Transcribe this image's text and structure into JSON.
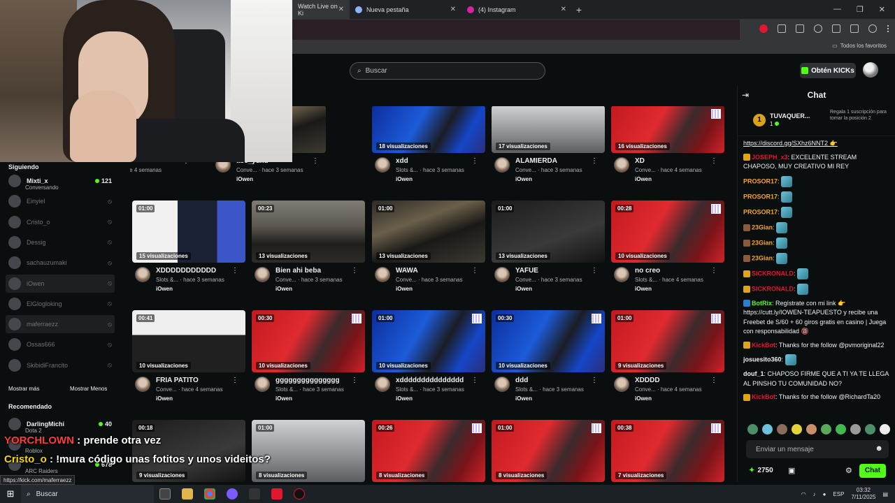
{
  "browser": {
    "tabs": [
      {
        "label": "Watch Live on Ki"
      },
      {
        "label": "Nueva pestaña"
      },
      {
        "label": "(4) Instagram"
      }
    ],
    "new_tab": "+",
    "bookmarks_all": "Todos los favoritos"
  },
  "header": {
    "search_placeholder": "Buscar",
    "get_kicks": "Obtén KICKs"
  },
  "sidebar": {
    "following_title": "Siguiendo",
    "following": [
      {
        "name": "Mixti_x",
        "sub": "Conversando",
        "count": "121",
        "live": true
      },
      {
        "name": "Einyiel",
        "live": false
      },
      {
        "name": "Cristo_o",
        "live": false
      },
      {
        "name": "Dessig",
        "live": false
      },
      {
        "name": "sachauzumaki",
        "live": false
      },
      {
        "name": "iOwen",
        "live": false
      },
      {
        "name": "ElGlogloking",
        "live": false
      },
      {
        "name": "maferraezz",
        "live": false
      },
      {
        "name": "Ossas666",
        "live": false
      },
      {
        "name": "SkibidiFrancito",
        "live": false
      }
    ],
    "show_more": "Mostrar más",
    "show_less": "Mostrar Menos",
    "recommended_title": "Recomendado",
    "recommended": [
      {
        "name": "DarlingMichi",
        "sub": "Dota 2",
        "count": "40"
      },
      {
        "name": "",
        "sub": "Roblox",
        "count": ""
      },
      {
        "name": "",
        "sub": "ARC Raiders",
        "count": "678"
      }
    ]
  },
  "videos": [
    {
      "duration": "",
      "views": "",
      "title": "",
      "meta": "IRL · hace 4 semanas",
      "channel": "iOwen",
      "style": "t-night"
    },
    {
      "duration": "",
      "views": "ciones",
      "title": "ase_yuxd",
      "meta": "Conve... · hace 3 semanas",
      "channel": "iOwen",
      "style": "t-night"
    },
    {
      "duration": "",
      "views": "18 visualizaciones",
      "title": "xdd",
      "meta": "Slots &... · hace 3 semanas",
      "channel": "iOwen",
      "style": "t-blue"
    },
    {
      "duration": "",
      "views": "17 visualizaciones",
      "title": "ALAMIERDA",
      "meta": "Conve... · hace 3 semanas",
      "channel": "iOwen",
      "style": "t-light"
    },
    {
      "duration": "",
      "views": "16 visualizaciones",
      "title": "XD",
      "meta": "Conve... · hace 4 semanas",
      "channel": "iOwen",
      "style": "t-red"
    },
    {
      "duration": "01:00",
      "views": "15 visualizaciones",
      "title": "XDDDDDDDDDDD",
      "meta": "Slots &... · hace 3 semanas",
      "channel": "iOwen",
      "style": "t-screen"
    },
    {
      "duration": "00:23",
      "views": "13 visualizaciones",
      "title": "Bien ahi beba",
      "meta": "Conve... · hace 3 semanas",
      "channel": "iOwen",
      "style": "t-street"
    },
    {
      "duration": "01:00",
      "views": "13 visualizaciones",
      "title": "WAWA",
      "meta": "Conve... · hace 3 semanas",
      "channel": "iOwen",
      "style": "t-night"
    },
    {
      "duration": "01:00",
      "views": "13 visualizaciones",
      "title": "YAFUE",
      "meta": "Conve... · hace 3 semanas",
      "channel": "iOwen",
      "style": "t-dark"
    },
    {
      "duration": "00:28",
      "views": "10 visualizaciones",
      "title": "no creo",
      "meta": "Slots &... · hace 4 semanas",
      "channel": "iOwen",
      "style": "t-red"
    },
    {
      "duration": "00:41",
      "views": "10 visualizaciones",
      "title": "FRIA PATITO",
      "meta": "Conve... · hace 4 semanas",
      "channel": "iOwen",
      "style": "t-white"
    },
    {
      "duration": "00:30",
      "views": "10 visualizaciones",
      "title": "ggggggggggggggg",
      "meta": "Slots &... · hace 3 semanas",
      "channel": "iOwen",
      "style": "t-red"
    },
    {
      "duration": "01:00",
      "views": "10 visualizaciones",
      "title": "xddddddddddddddd",
      "meta": "Slots &... · hace 3 semanas",
      "channel": "iOwen",
      "style": "t-blue"
    },
    {
      "duration": "00:30",
      "views": "10 visualizaciones",
      "title": "ddd",
      "meta": "Slots &... · hace 3 semanas",
      "channel": "iOwen",
      "style": "t-blue"
    },
    {
      "duration": "01:00",
      "views": "9 visualizaciones",
      "title": "XDDDD",
      "meta": "Conve... · hace 4 semanas",
      "channel": "iOwen",
      "style": "t-red"
    },
    {
      "duration": "00:18",
      "views": "9 visualizaciones",
      "title": "",
      "meta": "",
      "channel": "",
      "style": "t-dark"
    },
    {
      "duration": "01:00",
      "views": "8 visualizaciones",
      "title": "",
      "meta": "",
      "channel": "",
      "style": "t-light"
    },
    {
      "duration": "00:26",
      "views": "8 visualizaciones",
      "title": "",
      "meta": "",
      "channel": "",
      "style": "t-red"
    },
    {
      "duration": "01:00",
      "views": "8 visualizaciones",
      "title": "",
      "meta": "",
      "channel": "",
      "style": "t-red"
    },
    {
      "duration": "00:38",
      "views": "7 visualizaciones",
      "title": "",
      "meta": "",
      "channel": "",
      "style": "t-red"
    }
  ],
  "chat": {
    "title": "Chat",
    "pinned": {
      "name": "TUVAQUER...",
      "count": "1",
      "gift_text": "Regala 1 suscripción para tomar la posición 2",
      "rank": "1"
    },
    "messages": [
      {
        "user": "",
        "text": "https://discord.gg/SXhz6NNT2 👉",
        "color": "#efeff1"
      },
      {
        "user": "JOSEPH_x3",
        "text": "EXCELENTE STREAM CHAPOSO, MUY CREATIVO MI REY",
        "color": "#e0182f"
      },
      {
        "user": "PROSOR17",
        "text": "",
        "color": "#f5a623"
      },
      {
        "user": "PROSOR17",
        "text": "",
        "color": "#f5a623"
      },
      {
        "user": "PROSOR17",
        "text": "",
        "color": "#f5a623"
      },
      {
        "user": "23Gian",
        "text": "",
        "color": "#f5a623"
      },
      {
        "user": "23Gian",
        "text": "",
        "color": "#f5a623"
      },
      {
        "user": "23Gian",
        "text": "",
        "color": "#f5a623"
      },
      {
        "user": "SICKRONALD",
        "text": "",
        "color": "#e0182f"
      },
      {
        "user": "SICKRONALD",
        "text": "",
        "color": "#e0182f"
      },
      {
        "user": "BotRix",
        "text": "Regístrate con mi link 👉 https://cutt.ly/IOWEN-TEAPUESTO y recibe una Freebet de S/60 + 60 giros gratis en casino | Juega con responsabilidad 🔞",
        "color": "#53fc18"
      },
      {
        "user": "KickBot",
        "text": "Thanks for the follow @pvmoriginal22",
        "color": "#e0182f"
      },
      {
        "user": "josuesito360",
        "text": "",
        "color": "#efeff1"
      },
      {
        "user": "douf_1",
        "text": "CHAPOSO FIRME QUE A TI YA TE LLEGA AL PINSHO TU COMUNIDAD NO?",
        "color": "#efeff1"
      },
      {
        "user": "KickBot",
        "text": "Thanks for the follow @RichardTa20",
        "color": "#e0182f"
      }
    ],
    "input_placeholder": "Enviar un mensaje",
    "kicks_balance": "2750",
    "send_label": "Chat"
  },
  "overlay_chat": [
    {
      "user": "YORCHLOWN",
      "text": ": prende otra vez",
      "color": "#ff3b3b"
    },
    {
      "user": "Cristo_o",
      "text": ": !mura código unas fotitos y unos videitos?",
      "color": "#f5d21a"
    }
  ],
  "status_url": "https://kick.com/maferraezz",
  "taskbar": {
    "search": "Buscar",
    "time": "03:32",
    "date": "7/11/2025",
    "lang": "ESP"
  }
}
